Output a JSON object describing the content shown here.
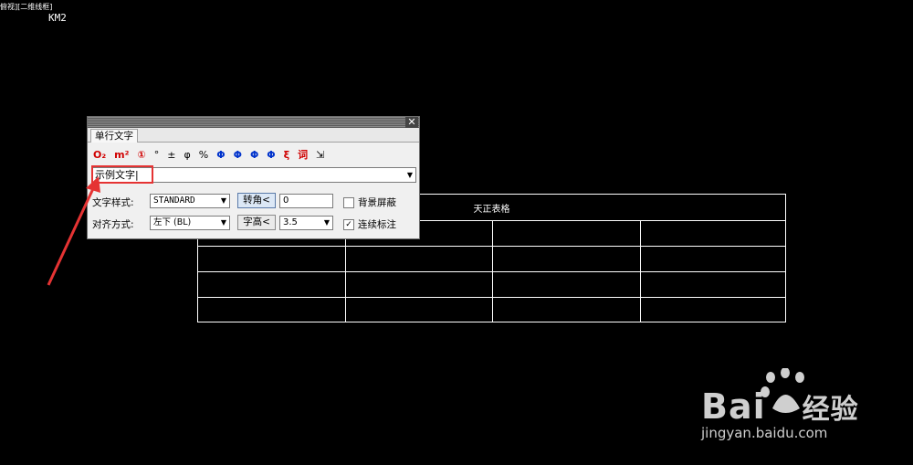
{
  "canvas": {
    "view_label": "俯视][二维线框]",
    "km_label": "KM2",
    "table_title": "天正表格"
  },
  "dialog": {
    "tab_label": "单行文字",
    "symbols": [
      {
        "label": "O₂",
        "color": "red",
        "name": "subscript-symbol"
      },
      {
        "label": "m²",
        "color": "red",
        "name": "superscript-symbol"
      },
      {
        "label": "①",
        "color": "red",
        "name": "circled-number-symbol"
      },
      {
        "label": "°",
        "color": "plain",
        "name": "degree-symbol"
      },
      {
        "label": "±",
        "color": "plain",
        "name": "plus-minus-symbol"
      },
      {
        "label": "φ",
        "color": "plain",
        "name": "diameter-symbol"
      },
      {
        "label": "%",
        "color": "plain",
        "name": "percent-symbol"
      },
      {
        "label": "Φ",
        "color": "blue",
        "name": "steel-grade-1-symbol"
      },
      {
        "label": "Φ",
        "color": "blue",
        "name": "steel-grade-2-symbol"
      },
      {
        "label": "Φ",
        "color": "blue",
        "name": "steel-grade-3-symbol"
      },
      {
        "label": "Φ",
        "color": "blue",
        "name": "steel-grade-4-symbol"
      },
      {
        "label": "ξ",
        "color": "red",
        "name": "special-char-symbol"
      },
      {
        "label": "词",
        "color": "red",
        "name": "word-lookup-symbol"
      },
      {
        "label": "⇲",
        "color": "plain",
        "name": "pick-text-icon"
      }
    ],
    "text_value": "示例文字",
    "style_label": "文字样式:",
    "style_value": "STANDARD",
    "rotate_button": "转角<",
    "rotate_value": "0",
    "bg_mask_label": "背景屏蔽",
    "bg_mask_checked": false,
    "align_label": "对齐方式:",
    "align_value": "左下 (BL)",
    "height_button": "字高<",
    "height_value": "3.5",
    "continuous_label": "连续标注",
    "continuous_checked": true
  },
  "watermark": {
    "brand_text": "Bai",
    "brand_suffix": "经验",
    "url": "jingyan.baidu.com"
  },
  "colors": {
    "highlight": "#e53333",
    "arrow": "#e53333"
  }
}
